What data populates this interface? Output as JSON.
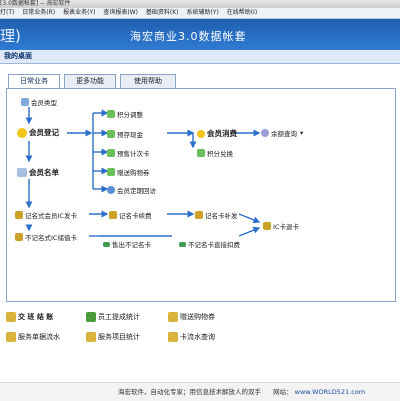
{
  "window": {
    "title": "[3.0数据帐套] -- 海宏软件"
  },
  "menu": [
    "打(T)",
    "日常业务(R)",
    "报表业务(Y)",
    "查询报表(W)",
    "基础资料(K)",
    "系统辅助(Y)",
    "在线帮助(I)"
  ],
  "banner": {
    "left_text": "理)",
    "title": "海宏商业3.0数据帐套"
  },
  "desk": {
    "title": "我的桌面"
  },
  "tabs": [
    "日常业务",
    "更多功能",
    "使用帮助"
  ],
  "flow": {
    "member_type": "会员类型",
    "member_register": "会员登记",
    "member_list": "会员名单",
    "points_adjust": "积分调整",
    "prepaid_cash": "预存现金",
    "prepaid_times": "预售计次卡",
    "gift_goods": "赠送购物券",
    "member_visit": "会员定期回访",
    "member_consume": "会员消费",
    "points_redeem": "积分兑换",
    "balance_query": "余额查询",
    "named_card_issue": "记名式会员IC发卡",
    "named_card_renew": "记名卡续费",
    "named_card_reissue": "记名卡补发",
    "ic_card_return": "IC卡退卡",
    "anon_card_sell": "不记名式IC储值卡",
    "anon_card_sold": "售出不记名卡",
    "anon_card_refund": "不记名卡直接扣费"
  },
  "bottom": {
    "settle": "交 班 结 账",
    "staff_commission": "员工提成统计",
    "gift_voucher": "赠送购物券",
    "service_flow": "服务单据流水",
    "service_stats": "服务项目统计",
    "card_flow": "卡流水查询"
  },
  "footer": {
    "text": "海宏软件，自动化专家；用信息技术解放人的双手",
    "site_label": "网站：",
    "site_url": "www.WORLD521.com"
  },
  "colors": {
    "banner": "#2f7bd2",
    "tab_border": "#8aa3c8",
    "arrow": "#2a6fc9"
  }
}
